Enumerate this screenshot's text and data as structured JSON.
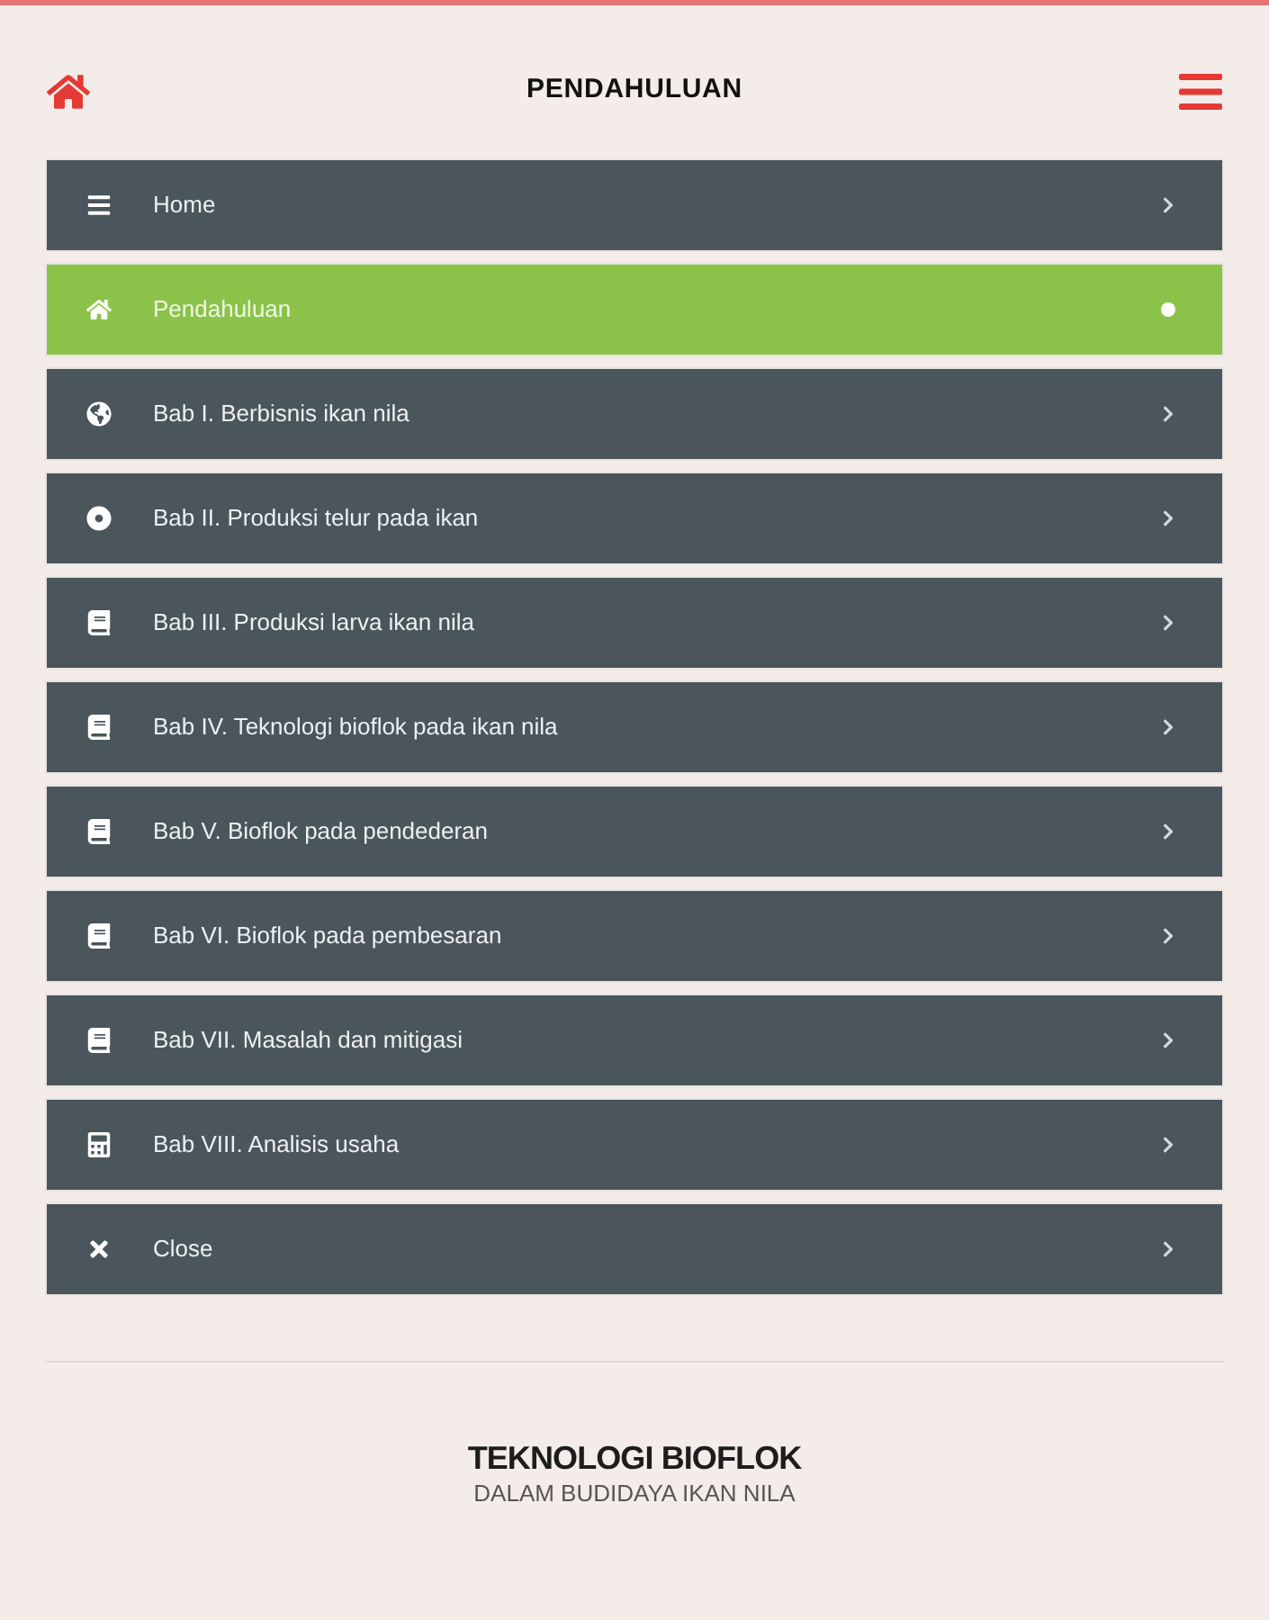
{
  "header": {
    "title": "PENDAHULUAN"
  },
  "menu": [
    {
      "kind": "bars",
      "label": "Home",
      "selected": false
    },
    {
      "kind": "home",
      "label": "Pendahuluan",
      "selected": true
    },
    {
      "kind": "globe",
      "label": "Bab I. Berbisnis ikan nila",
      "selected": false
    },
    {
      "kind": "target",
      "label": "Bab II. Produksi telur pada ikan",
      "selected": false
    },
    {
      "kind": "book",
      "label": "Bab III. Produksi larva ikan nila",
      "selected": false
    },
    {
      "kind": "book",
      "label": "Bab IV. Teknologi bioflok pada ikan nila",
      "selected": false
    },
    {
      "kind": "book",
      "label": "Bab V. Bioflok pada pendederan",
      "selected": false
    },
    {
      "kind": "book",
      "label": "Bab VI. Bioflok pada pembesaran",
      "selected": false
    },
    {
      "kind": "book",
      "label": "Bab VII. Masalah dan mitigasi",
      "selected": false
    },
    {
      "kind": "calculator",
      "label": "Bab VIII. Analisis usaha",
      "selected": false
    },
    {
      "kind": "close",
      "label": "Close",
      "selected": false
    }
  ],
  "footer": {
    "title": "TEKNOLOGI BIOFLOK",
    "subtitle": "DALAM BUDIDAYA IKAN NILA"
  }
}
